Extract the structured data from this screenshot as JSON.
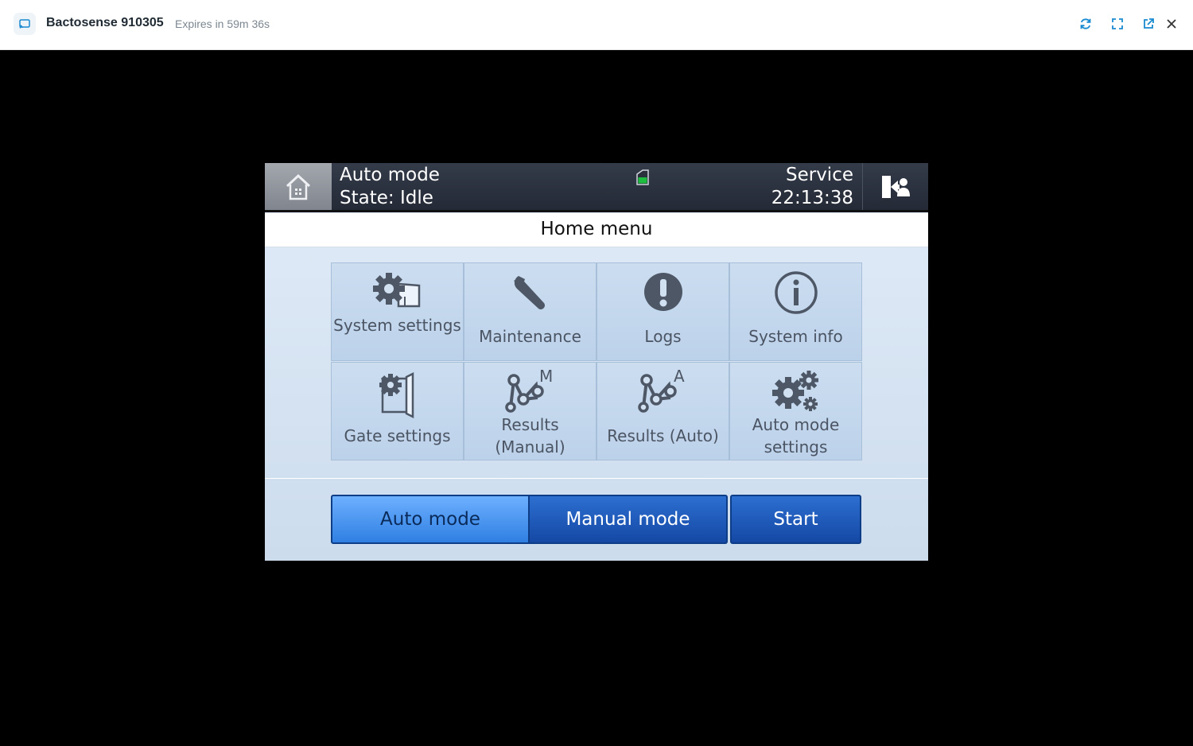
{
  "session": {
    "title": "Bactosense 910305",
    "expiry": "Expires in 59m 36s",
    "icons": [
      "cast-icon",
      "refresh-icon",
      "fullscreen-icon",
      "external-link-icon",
      "close-icon"
    ],
    "accent_color": "#1a8ad0"
  },
  "status": {
    "mode": "Auto mode",
    "state": "State: Idle",
    "user": "Service",
    "time": "22:13:38",
    "battery_color": "#1ebd3f"
  },
  "menu": {
    "title": "Home menu",
    "tiles": [
      {
        "label": "System settings",
        "icon": "system-settings-icon"
      },
      {
        "label": "Maintenance",
        "icon": "wrench-icon"
      },
      {
        "label": "Logs",
        "icon": "exclamation-icon"
      },
      {
        "label": "System info",
        "icon": "info-icon"
      },
      {
        "label": "Gate settings",
        "icon": "gate-settings-icon"
      },
      {
        "label": "Results (Manual)",
        "icon": "results-manual-icon"
      },
      {
        "label": "Results (Auto)",
        "icon": "results-auto-icon"
      },
      {
        "label": "Auto mode settings",
        "icon": "auto-mode-settings-icon"
      }
    ]
  },
  "controls": {
    "auto_mode": "Auto mode",
    "manual_mode": "Manual mode",
    "start": "Start",
    "active_mode": "Auto mode"
  }
}
